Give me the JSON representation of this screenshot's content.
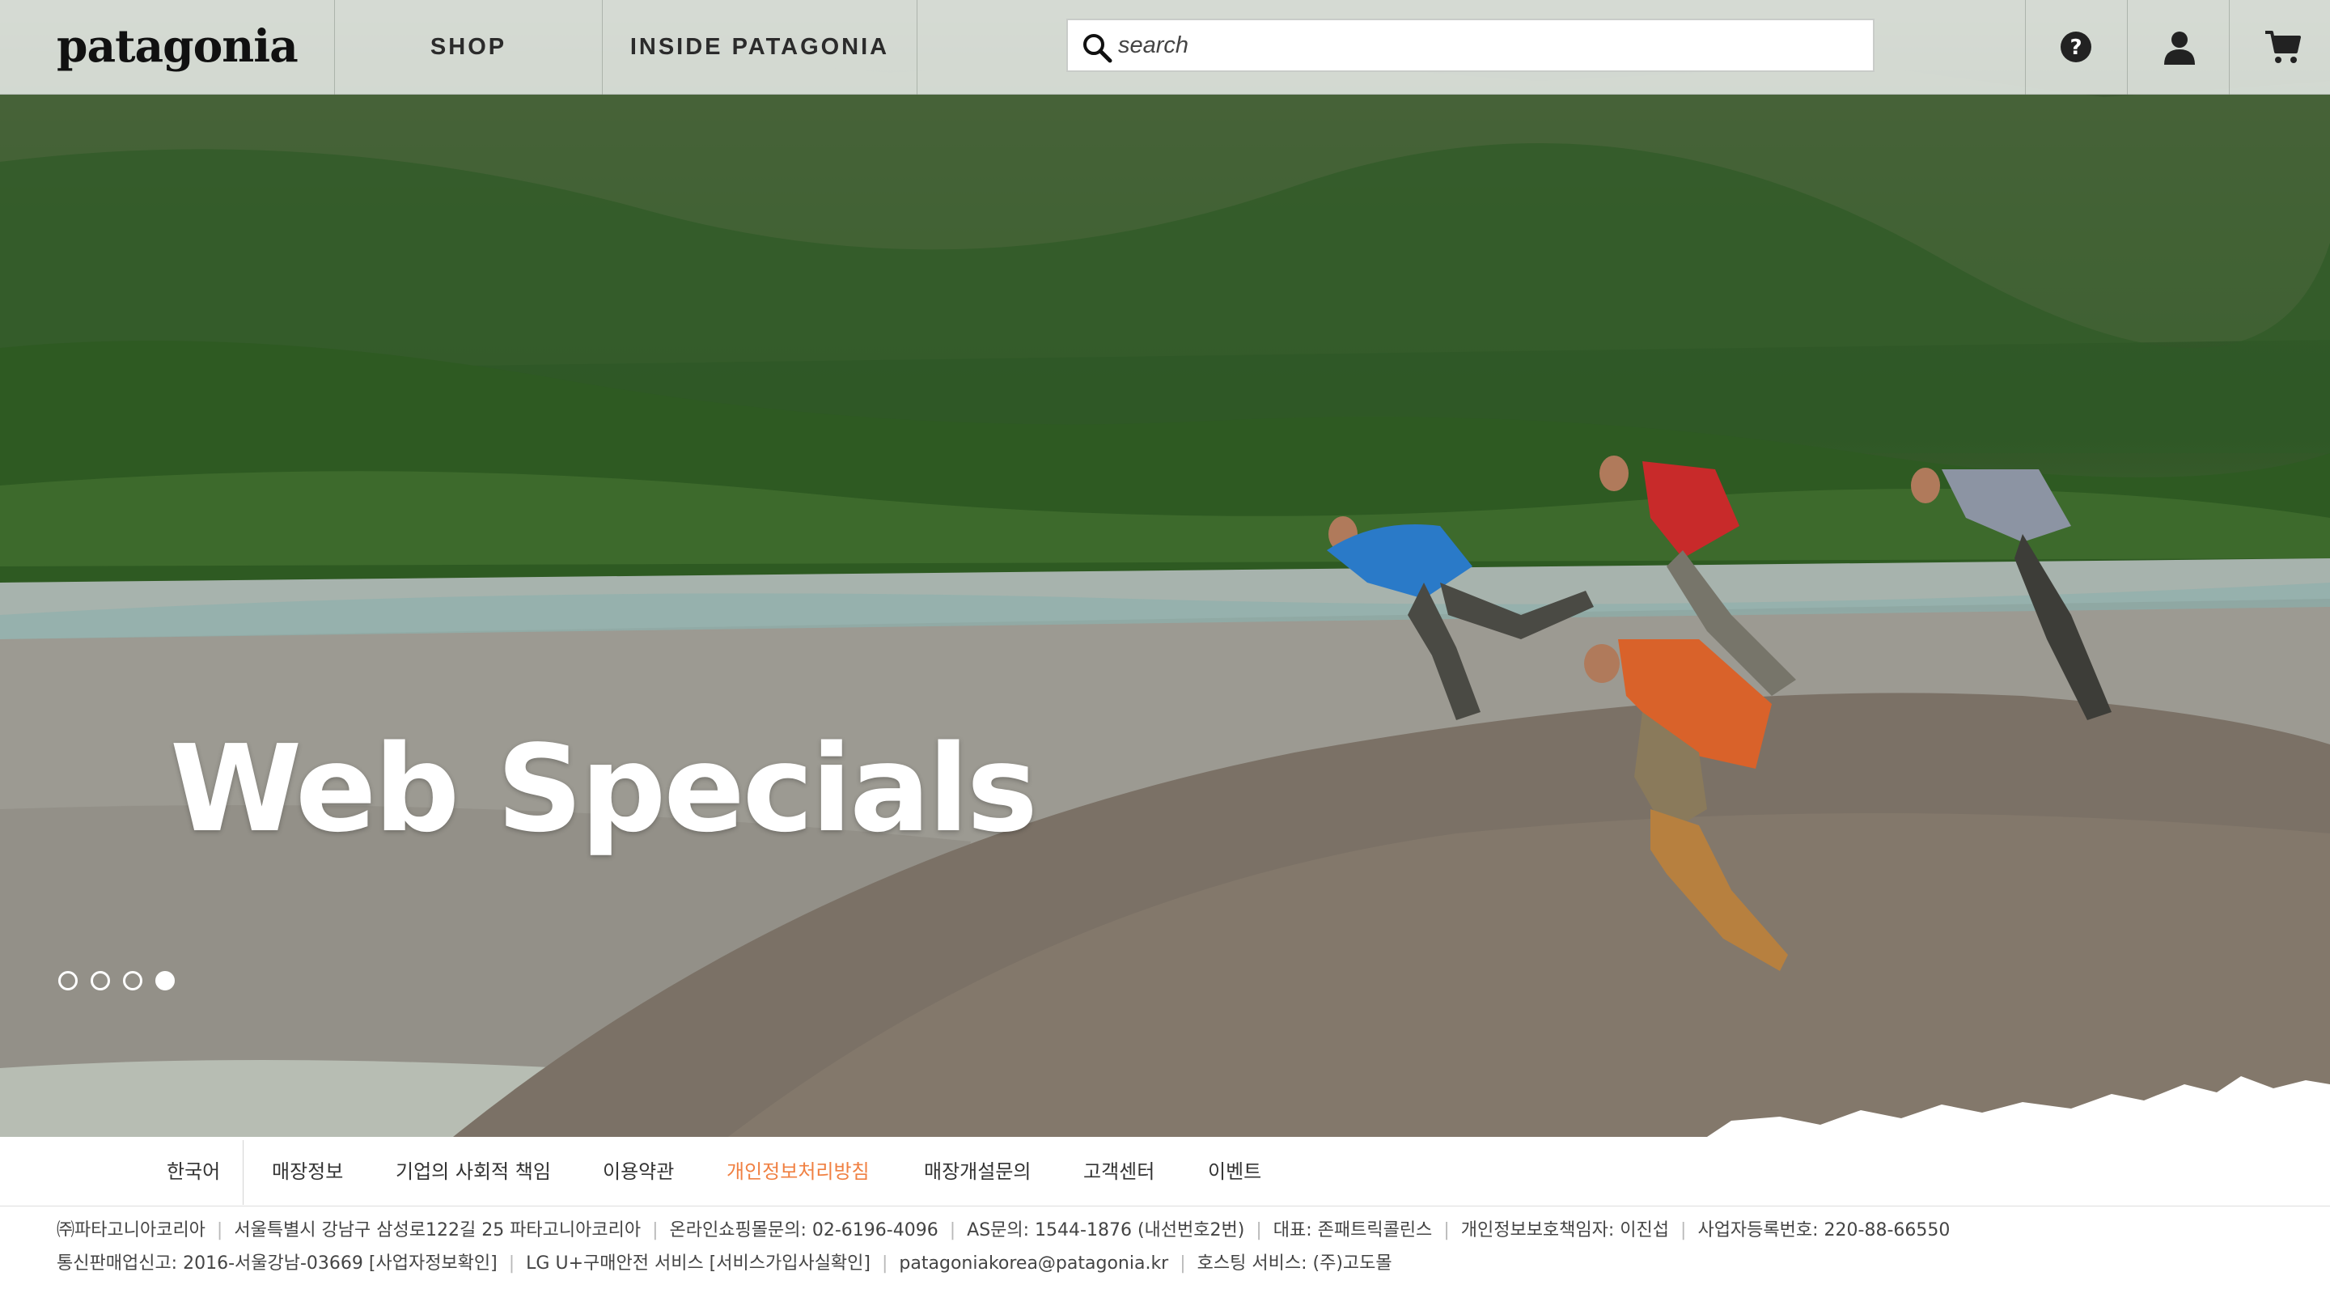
{
  "header": {
    "logo_text": "patagonia",
    "nav": [
      {
        "label": "SHOP"
      },
      {
        "label": "INSIDE PATAGONIA"
      }
    ],
    "search": {
      "placeholder": "search",
      "value": ""
    },
    "tools": [
      {
        "icon": "help-icon"
      },
      {
        "icon": "account-icon"
      },
      {
        "icon": "cart-icon"
      }
    ]
  },
  "hero": {
    "title": "Web Specials",
    "slides": {
      "count": 4,
      "active_index": 3
    }
  },
  "footer_nav": {
    "items": [
      {
        "label": "한국어",
        "highlight": false
      },
      {
        "label": "매장정보",
        "highlight": false
      },
      {
        "label": "기업의 사회적 책임",
        "highlight": false
      },
      {
        "label": "이용약관",
        "highlight": false
      },
      {
        "label": "개인정보처리방침",
        "highlight": true
      },
      {
        "label": "매장개설문의",
        "highlight": false
      },
      {
        "label": "고객센터",
        "highlight": false
      },
      {
        "label": "이벤트",
        "highlight": false
      }
    ],
    "highlight_color": "#f08042"
  },
  "corporate_info": {
    "line1": [
      "㈜파타고니아코리아",
      "서울특별시 강남구 삼성로122길 25 파타고니아코리아",
      "온라인쇼핑몰문의: 02-6196-4096",
      "AS문의: 1544-1876 (내선번호2번)",
      "대표: 존패트릭콜린스",
      "개인정보보호책임자: 이진섭",
      "사업자등록번호: 220-88-66550"
    ],
    "line2": [
      "통신판매업신고: 2016-서울강남-03669 [사업자정보확인]",
      "LG U+구매안전 서비스 [서비스가입사실확인]",
      "patagoniakorea@patagonia.kr",
      "호스팅 서비스: (주)고도몰"
    ]
  }
}
